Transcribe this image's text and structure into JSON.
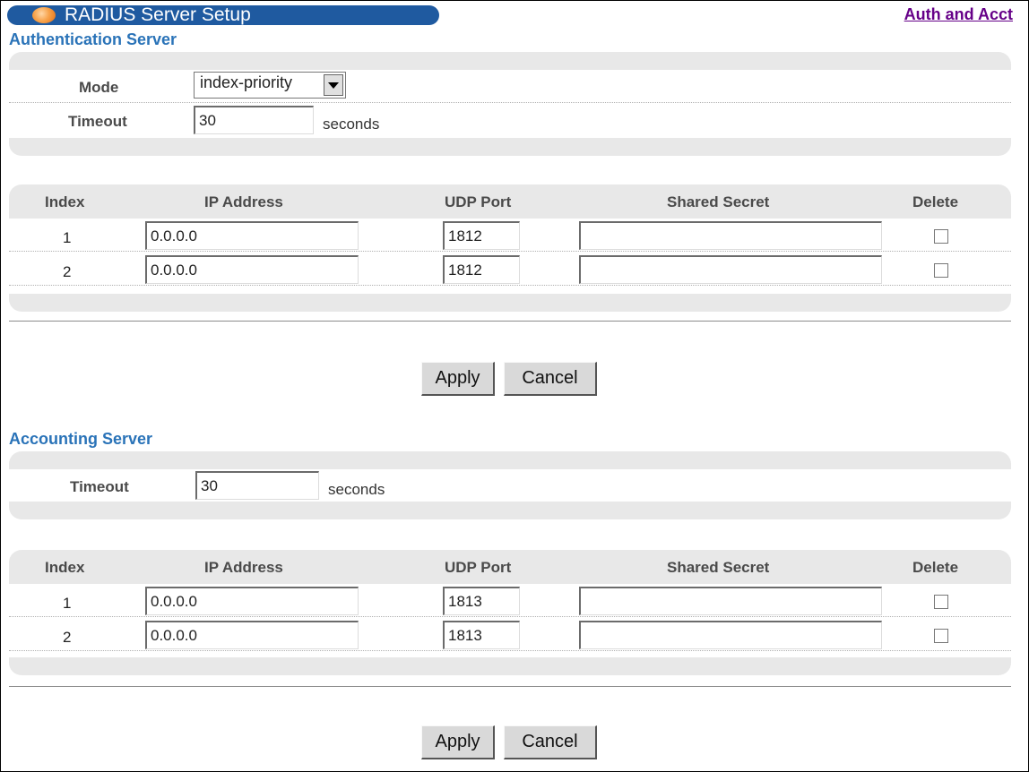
{
  "header": {
    "title": "RADIUS Server Setup",
    "link": "Auth and Acct"
  },
  "auth": {
    "title": "Authentication Server",
    "mode_label": "Mode",
    "mode_value": "index-priority",
    "timeout_label": "Timeout",
    "timeout_value": "30",
    "timeout_unit": "seconds",
    "columns": [
      "Index",
      "IP Address",
      "UDP Port",
      "Shared Secret",
      "Delete"
    ],
    "rows": [
      {
        "index": "1",
        "ip": "0.0.0.0",
        "port": "1812",
        "secret": "",
        "delete": false
      },
      {
        "index": "2",
        "ip": "0.0.0.0",
        "port": "1812",
        "secret": "",
        "delete": false
      }
    ],
    "apply_label": "Apply",
    "cancel_label": "Cancel"
  },
  "acct": {
    "title": "Accounting Server",
    "timeout_label": "Timeout",
    "timeout_value": "30",
    "timeout_unit": "seconds",
    "columns": [
      "Index",
      "IP Address",
      "UDP Port",
      "Shared Secret",
      "Delete"
    ],
    "rows": [
      {
        "index": "1",
        "ip": "0.0.0.0",
        "port": "1813",
        "secret": "",
        "delete": false
      },
      {
        "index": "2",
        "ip": "0.0.0.0",
        "port": "1813",
        "secret": "",
        "delete": false
      }
    ],
    "apply_label": "Apply",
    "cancel_label": "Cancel"
  },
  "colors": {
    "title_bar": "#1f5aa0",
    "section_title": "#2a73b8",
    "link": "#660088",
    "panel_cap": "#e8e8e8"
  }
}
